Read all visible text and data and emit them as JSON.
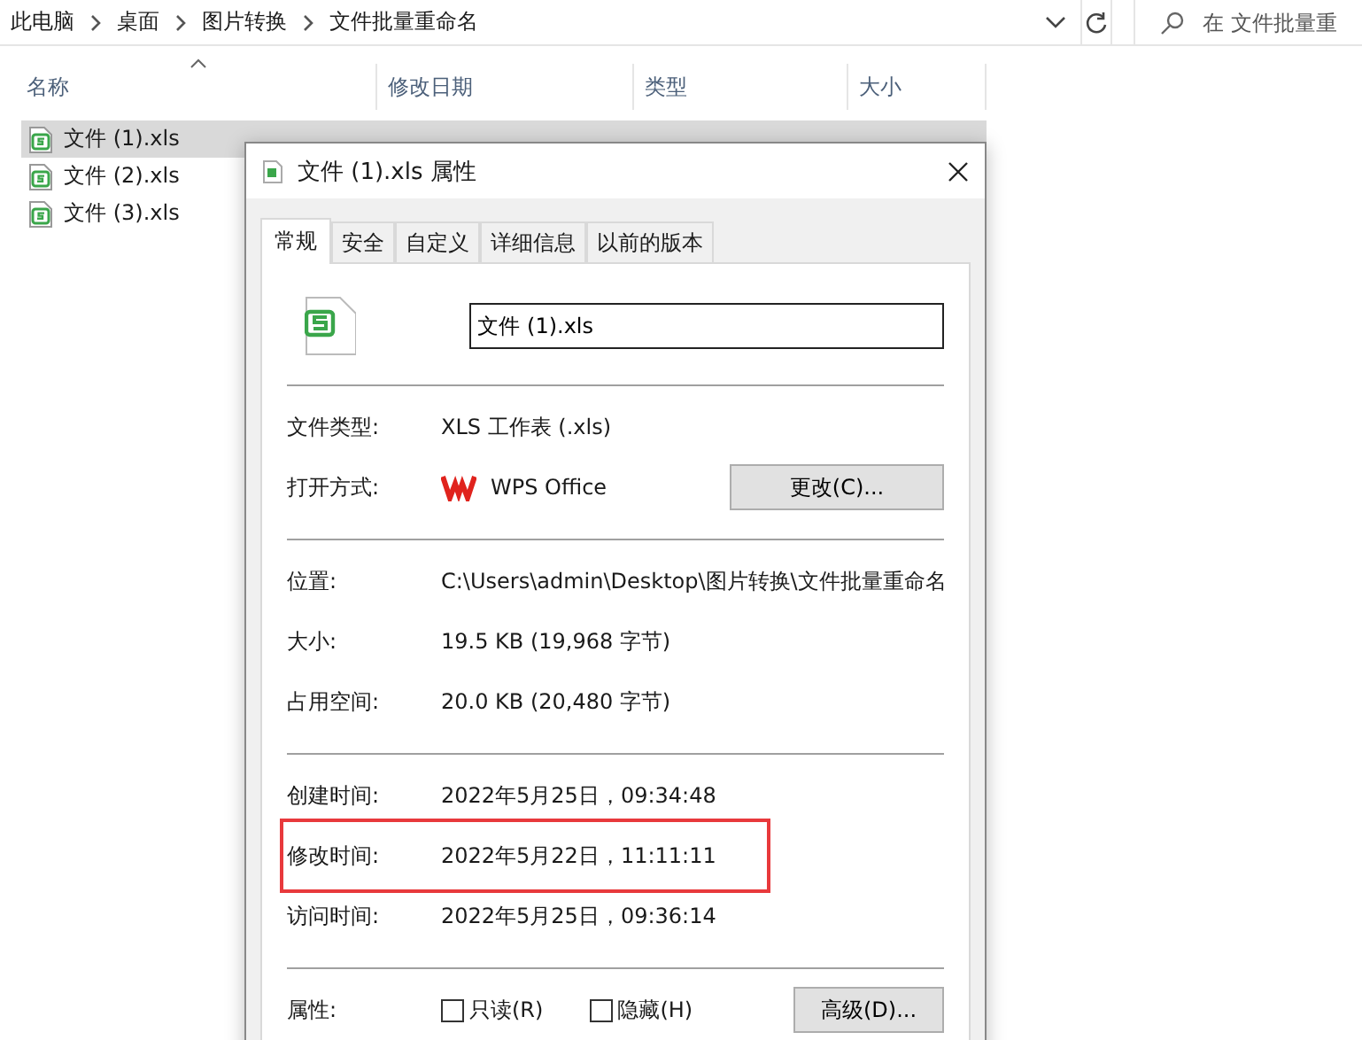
{
  "breadcrumb": [
    "此电脑",
    "桌面",
    "图片转换",
    "文件批量重命名"
  ],
  "search": {
    "placeholder": "在 文件批量重"
  },
  "columns": [
    "名称",
    "修改日期",
    "类型",
    "大小"
  ],
  "files": [
    {
      "name": "文件 (1).xls",
      "selected": true
    },
    {
      "name": "文件 (2).xls",
      "selected": false
    },
    {
      "name": "文件 (3).xls",
      "selected": false
    }
  ],
  "dialog": {
    "title": "文件 (1).xls 属性",
    "tabs": [
      {
        "label": "常规",
        "selected": true
      },
      {
        "label": "安全",
        "selected": false
      },
      {
        "label": "自定义",
        "selected": false
      },
      {
        "label": "详细信息",
        "selected": false
      },
      {
        "label": "以前的版本",
        "selected": false
      }
    ],
    "file_name": "文件 (1).xls",
    "sections": [
      [
        {
          "kind": "text",
          "label": "文件类型:",
          "value": "XLS 工作表 (.xls)",
          "highlighted": false
        },
        {
          "kind": "app",
          "label": "打开方式:",
          "value": "WPS Office",
          "button": "更改(C)...",
          "highlighted": false
        }
      ],
      [
        {
          "kind": "text",
          "label": "位置:",
          "value": "C:\\Users\\admin\\Desktop\\图片转换\\文件批量重命名",
          "highlighted": false
        },
        {
          "kind": "text",
          "label": "大小:",
          "value": "19.5 KB (19,968 字节)",
          "highlighted": false
        },
        {
          "kind": "text",
          "label": "占用空间:",
          "value": "20.0 KB (20,480 字节)",
          "highlighted": false
        }
      ],
      [
        {
          "kind": "text",
          "label": "创建时间:",
          "value": "2022年5月25日，09:34:48",
          "highlighted": false
        },
        {
          "kind": "text",
          "label": "修改时间:",
          "value": "2022年5月22日，11:11:11",
          "highlighted": true
        },
        {
          "kind": "text",
          "label": "访问时间:",
          "value": "2022年5月25日，09:36:14",
          "highlighted": false
        }
      ],
      [
        {
          "kind": "attributes",
          "label": "属性:",
          "checkboxes": [
            {
              "label": "只读(R)",
              "checked": false
            },
            {
              "label": "隐藏(H)",
              "checked": false
            }
          ],
          "button": "高级(D)...",
          "highlighted": false
        }
      ]
    ]
  }
}
